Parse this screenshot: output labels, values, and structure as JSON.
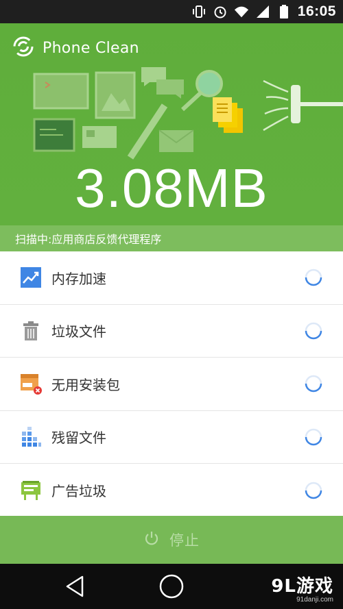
{
  "status_bar": {
    "time": "16:05",
    "icons": [
      "vibrate-icon",
      "alarm-icon",
      "wifi-icon",
      "signal-icon",
      "battery-icon"
    ]
  },
  "app": {
    "title": "Phone Clean",
    "logo_icon": "app-logo-icon"
  },
  "scan": {
    "size": "3.08MB",
    "status_text": "扫描中:应用商店反馈代理程序"
  },
  "items": [
    {
      "label": "内存加速",
      "icon": "memory-boost-icon"
    },
    {
      "label": "垃圾文件",
      "icon": "trash-can-icon"
    },
    {
      "label": "无用安装包",
      "icon": "apk-package-icon"
    },
    {
      "label": "残留文件",
      "icon": "residual-files-icon"
    },
    {
      "label": "广告垃圾",
      "icon": "ad-junk-icon"
    }
  ],
  "stop_button": {
    "label": "停止",
    "icon": "power-icon"
  },
  "navigation": {
    "back": "back-icon",
    "home": "home-icon"
  },
  "watermark": {
    "main": "9L游戏",
    "sub": "91danji.com"
  },
  "colors": {
    "header_green": "#5fae3b",
    "scan_bar": "#7dbd5d",
    "stop_bar": "#77b956",
    "spinner_blue": "#3f86e4"
  }
}
